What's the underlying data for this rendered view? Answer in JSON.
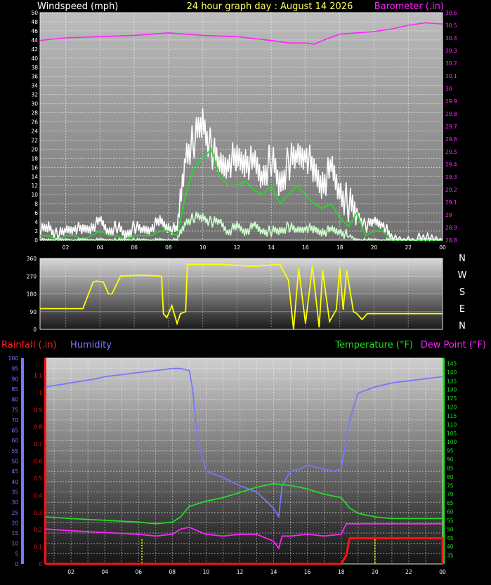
{
  "header": {
    "title": "24 hour graph day : August 14 2026",
    "wind_label": "Windspeed (mph)",
    "baro_label": "Barometer (.in)"
  },
  "lower_header": {
    "rain_label": "Rainfall (.in)",
    "humidity_label": "Humidity",
    "temp_label": "Temperature (°F)",
    "dew_label": "Dew Point (°F)"
  },
  "compass": [
    "N",
    "W",
    "S",
    "E",
    "N"
  ],
  "colors": {
    "title": "#ffff66",
    "wind_gust": "#ffffff",
    "wind_avg": "#22dd22",
    "wind_low": "#ccffcc",
    "barometer": "#ff22ff",
    "direction": "#ffff00",
    "rain": "#ff1111",
    "humidity": "#7777ff",
    "temperature": "#22dd22",
    "dewpoint": "#ff22ff"
  },
  "chart_data": [
    {
      "type": "line",
      "name": "wind-baro",
      "x_ticks": [
        "02",
        "04",
        "06",
        "08",
        "10",
        "12",
        "14",
        "16",
        "18",
        "20",
        "22",
        "00"
      ],
      "x_range_hours": [
        0.5,
        24
      ],
      "y_left_ticks": [
        "0",
        "2",
        "4",
        "6",
        "8",
        "10",
        "12",
        "14",
        "16",
        "18",
        "20",
        "22",
        "24",
        "26",
        "28",
        "30",
        "32",
        "34",
        "36",
        "38",
        "40",
        "42",
        "44",
        "46",
        "48",
        "50"
      ],
      "y_left_range": [
        0,
        50
      ],
      "y_right_ticks": [
        "28.8",
        "28.9",
        "29",
        "29.1",
        "29.2",
        "29.3",
        "29.4",
        "29.5",
        "29.6",
        "29.7",
        "29.8",
        "29.9",
        "30",
        "30.1",
        "30.2",
        "30.3",
        "30.4",
        "30.5",
        "30.6"
      ],
      "y_right_range": [
        28.8,
        30.6
      ],
      "series": [
        {
          "key": "gust",
          "x": [
            0.5,
            1,
            1.5,
            2,
            2.5,
            3,
            3.5,
            4,
            4.5,
            5,
            5.5,
            6,
            6.5,
            7,
            7.5,
            8,
            8.5,
            9,
            9.5,
            10,
            10.5,
            11,
            11.5,
            12,
            12.5,
            13,
            13.5,
            14,
            14.5,
            15,
            15.5,
            16,
            16.5,
            17,
            17.5,
            18,
            18.5,
            19,
            19.5,
            20,
            20.5,
            21,
            22,
            23,
            24
          ],
          "y": [
            2,
            3,
            1,
            2,
            3,
            2,
            3,
            4,
            2,
            3,
            1,
            3,
            2,
            3,
            4,
            3,
            2,
            19,
            22,
            26,
            20,
            16,
            18,
            17,
            18,
            16,
            14,
            18,
            12,
            17,
            18,
            20,
            14,
            13,
            15,
            11,
            8,
            6,
            3,
            4,
            4,
            0,
            0,
            0,
            0
          ]
        },
        {
          "key": "avg",
          "x": [
            0.5,
            1,
            1.5,
            2,
            2.5,
            3,
            3.5,
            4,
            4.5,
            5,
            5.5,
            6,
            6.5,
            7,
            7.5,
            8,
            8.5,
            9,
            9.5,
            10,
            10.5,
            11,
            11.5,
            12,
            12.5,
            13,
            13.5,
            14,
            14.5,
            15,
            15.5,
            16,
            16.5,
            17,
            17.5,
            18,
            18.5,
            19,
            19.5,
            20,
            20.5,
            21,
            22,
            23,
            24
          ],
          "y": [
            1,
            1,
            0,
            1,
            1,
            0,
            1,
            2,
            1,
            1,
            0,
            1,
            1,
            1,
            2,
            2,
            1,
            10,
            16,
            18,
            20,
            14,
            12,
            12,
            13,
            11,
            10,
            12,
            8,
            10,
            12,
            10,
            8,
            7,
            8,
            5,
            3,
            6,
            1,
            2,
            2,
            0,
            0,
            0,
            0
          ]
        },
        {
          "key": "low",
          "x": [
            0.5,
            1,
            1.5,
            2,
            2.5,
            3,
            3.5,
            4,
            4.5,
            5,
            5.5,
            6,
            6.5,
            7,
            7.5,
            8,
            8.5,
            9,
            9.5,
            10,
            10.5,
            11,
            11.5,
            12,
            12.5,
            13,
            13.5,
            14,
            14.5,
            15,
            15.5,
            16,
            16.5,
            17,
            17.5,
            18,
            18.5,
            19,
            19.5,
            20,
            20.5,
            21,
            22,
            23,
            24
          ],
          "y": [
            0,
            0,
            0,
            0,
            0,
            0,
            0,
            0,
            0,
            0,
            0,
            0,
            0,
            0,
            0,
            0,
            0,
            4,
            5,
            5,
            4,
            4,
            2,
            3,
            2,
            3,
            2,
            2,
            2,
            3,
            2,
            3,
            2,
            2,
            2,
            2,
            1,
            0,
            0,
            0,
            0,
            0,
            0,
            0,
            0
          ]
        },
        {
          "key": "baro",
          "x": [
            0.5,
            2,
            4,
            6,
            8,
            10,
            12,
            14,
            15,
            16,
            16.5,
            17,
            18,
            19,
            20,
            21,
            22,
            23,
            24
          ],
          "y": [
            30.38,
            30.4,
            30.41,
            30.42,
            30.44,
            30.42,
            30.41,
            30.38,
            30.36,
            30.36,
            30.35,
            30.38,
            30.43,
            30.44,
            30.45,
            30.47,
            30.5,
            30.52,
            30.51
          ]
        }
      ]
    },
    {
      "type": "line",
      "name": "wind-direction",
      "x_range_hours": [
        0.5,
        24
      ],
      "y_ticks": [
        "0",
        "90",
        "180",
        "270",
        "360"
      ],
      "y_range": [
        0,
        360
      ],
      "series": [
        {
          "key": "direction",
          "x": [
            0.5,
            3,
            3.6,
            3.8,
            4.2,
            4.5,
            4.7,
            5.2,
            6.4,
            7.6,
            7.7,
            7.9,
            8.2,
            8.5,
            8.7,
            9.0,
            9.1,
            11,
            13,
            14.5,
            15,
            15.3,
            15.6,
            16,
            16.4,
            16.8,
            17,
            17.4,
            17.8,
            18,
            18.2,
            18.4,
            18.8,
            19,
            19.3,
            19.6,
            20,
            21,
            22,
            23,
            24
          ],
          "y": [
            105,
            105,
            240,
            245,
            240,
            180,
            180,
            270,
            275,
            270,
            80,
            60,
            120,
            30,
            80,
            90,
            330,
            330,
            320,
            330,
            250,
            0,
            310,
            30,
            320,
            10,
            300,
            40,
            100,
            310,
            100,
            300,
            90,
            80,
            50,
            80,
            80,
            80,
            80,
            80,
            80
          ]
        }
      ]
    },
    {
      "type": "line",
      "name": "rain-humidity-temp",
      "x_ticks": [
        "02",
        "04",
        "06",
        "08",
        "10",
        "12",
        "14",
        "16",
        "18",
        "20",
        "22",
        "00"
      ],
      "x_range_hours": [
        0.5,
        24
      ],
      "y_left_ticks": [
        "0",
        "5",
        "10",
        "15",
        "20",
        "25",
        "30",
        "35",
        "40",
        "45",
        "50",
        "55",
        "60",
        "65",
        "70",
        "75",
        "80",
        "85",
        "90",
        "95",
        "100"
      ],
      "y_left_range": [
        0,
        100
      ],
      "y_rain_ticks": [
        "0",
        "0.1",
        "0.2",
        "0.3",
        "0.4",
        "0.5",
        "0.6",
        "0.7",
        "0.8",
        "0.9",
        "1",
        "1.1"
      ],
      "y_rain_range": [
        0,
        1.2
      ],
      "y_right_ticks": [
        "35",
        "40",
        "45",
        "50",
        "55",
        "60",
        "65",
        "70",
        "75",
        "80",
        "85",
        "90",
        "95",
        "100",
        "105",
        "110",
        "115",
        "120",
        "125",
        "130",
        "135",
        "140",
        "145"
      ],
      "y_right_range": [
        30,
        148
      ],
      "series": [
        {
          "key": "humidity",
          "x": [
            0.5,
            2,
            3.5,
            4,
            6,
            7,
            8,
            8.5,
            9,
            9.2,
            9.5,
            10,
            11,
            12,
            13,
            14,
            14.3,
            14.5,
            15,
            15.5,
            16,
            16.5,
            17,
            17.5,
            18,
            18.5,
            19,
            20,
            21,
            22,
            23,
            24
          ],
          "y": [
            86,
            88,
            90,
            91,
            93,
            94,
            95,
            95,
            94,
            85,
            60,
            45,
            42,
            38,
            35,
            27,
            23,
            38,
            45,
            46,
            48,
            47,
            46,
            45,
            46,
            70,
            83,
            86,
            88,
            89,
            90,
            91
          ]
        },
        {
          "key": "temperature",
          "x": [
            0.5,
            2,
            4,
            6,
            7,
            8,
            8.5,
            9,
            10,
            11,
            12,
            13,
            14,
            15,
            16,
            17,
            18,
            18.5,
            19,
            20,
            21,
            22,
            23,
            24
          ],
          "y": [
            57,
            56,
            55,
            54,
            53,
            54,
            57,
            63,
            66,
            68,
            71,
            74,
            76,
            75,
            73,
            70,
            68,
            62,
            59,
            57,
            56,
            56,
            56,
            56
          ]
        },
        {
          "key": "dewpoint",
          "x": [
            0.5,
            2,
            4,
            6,
            7,
            8,
            8.5,
            9,
            10,
            11,
            12,
            13,
            14,
            14.3,
            14.5,
            15,
            16,
            17,
            18,
            18.3,
            19,
            20,
            21,
            22,
            23,
            24
          ],
          "y": [
            50,
            49,
            48,
            47,
            46,
            47,
            50,
            51,
            47,
            46,
            47,
            47,
            43,
            39,
            46,
            46,
            47,
            46,
            47,
            53,
            53,
            53,
            53,
            53,
            53,
            53
          ]
        },
        {
          "key": "rain",
          "x": [
            0.5,
            18,
            18.3,
            18.5,
            24,
            24
          ],
          "y": [
            0,
            0,
            0.05,
            0.15,
            0.15,
            0
          ]
        }
      ]
    }
  ]
}
